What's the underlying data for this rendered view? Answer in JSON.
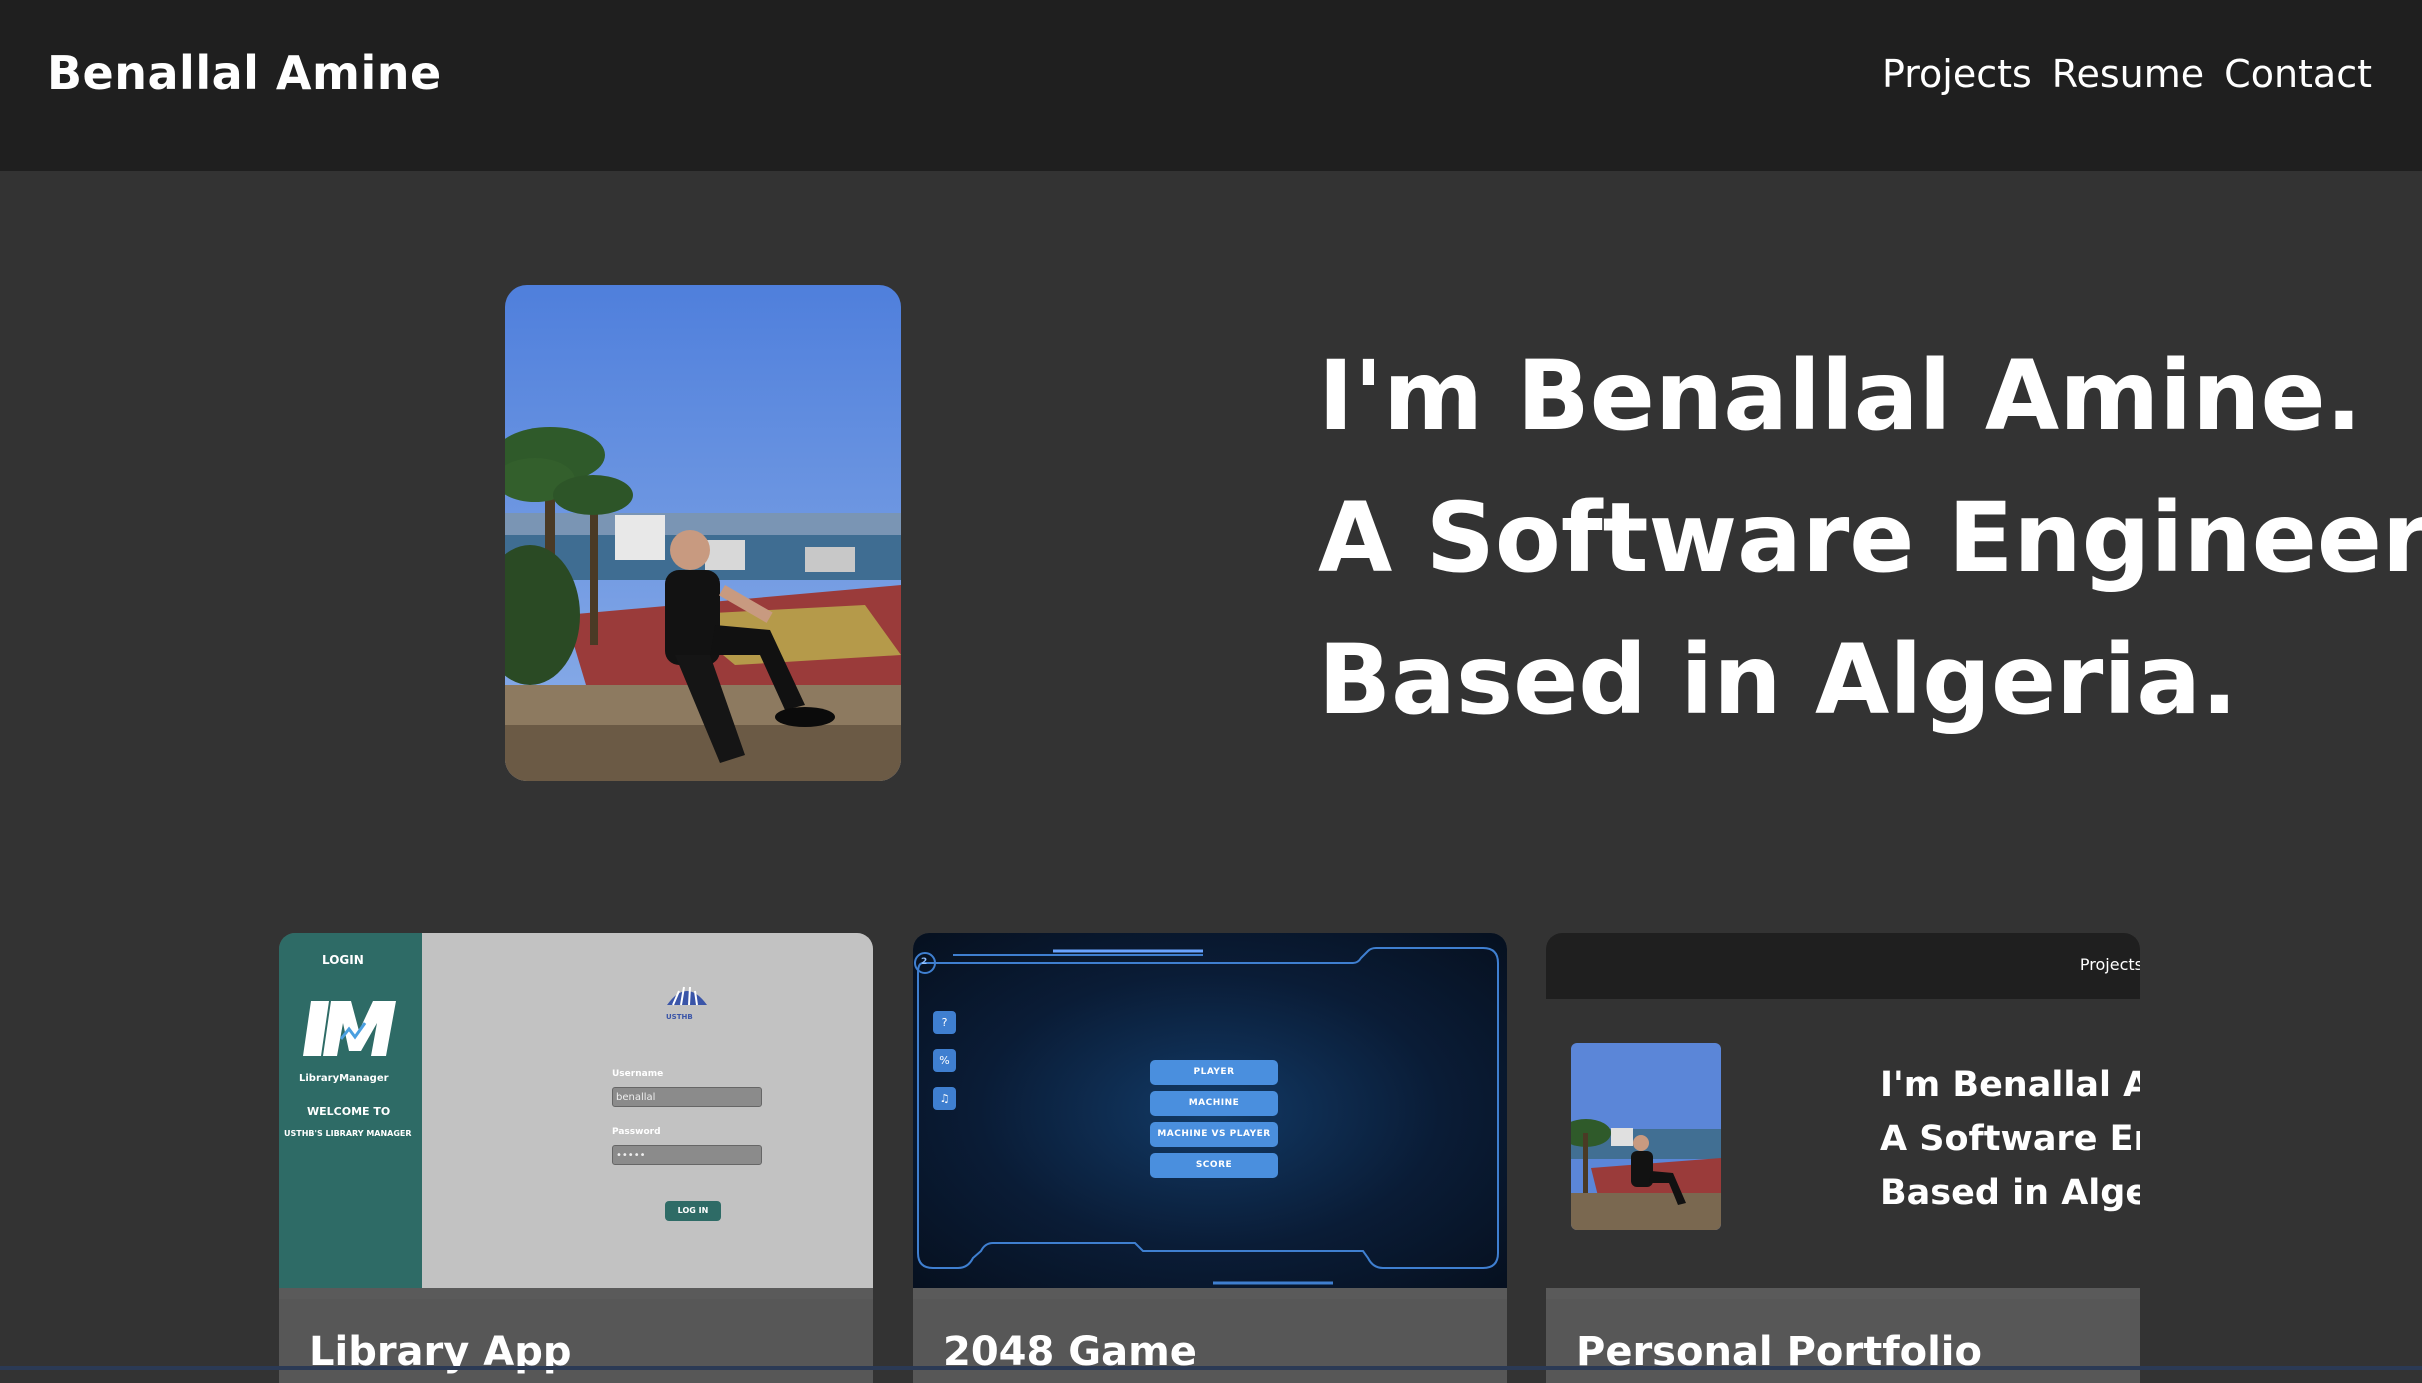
{
  "brand": "Benallal Amine",
  "nav": {
    "projects": "Projects",
    "resume": "Resume",
    "contact": "Contact"
  },
  "hero": {
    "lines": [
      "I'm Benallal Amine.",
      "A Software Engineer",
      "Based in Algeria."
    ]
  },
  "projects": [
    {
      "title": "Library App",
      "thumb": {
        "login": "LOGIN",
        "logo_sub": "LibraryManager",
        "welcome": "WELCOME TO",
        "subtitle": "USTHB'S LIBRARY MANAGER",
        "username_label": "Username",
        "username_value": "benallal",
        "password_label": "Password",
        "password_value": "•••••",
        "login_button": "LOG IN",
        "badge": "USTHB"
      }
    },
    {
      "title": "2048 Game",
      "thumb": {
        "buttons": [
          "PLAYER",
          "MACHINE",
          "MACHINE VS PLAYER",
          "SCORE"
        ],
        "side_icons": [
          "?",
          "%",
          "♫"
        ],
        "corner": "2"
      }
    },
    {
      "title": "Personal Portfolio",
      "thumb": {
        "nav": "Projects",
        "lines": [
          "I'm Benallal Amine.",
          "A Software Engineer",
          "Based in Algeria."
        ]
      }
    }
  ],
  "colors": {
    "page_bg": "#333333",
    "nav_bg": "#1f1f1f",
    "card_footer": "#575757",
    "library_teal": "#2e6b66",
    "game_blue": "#4a8fde"
  }
}
